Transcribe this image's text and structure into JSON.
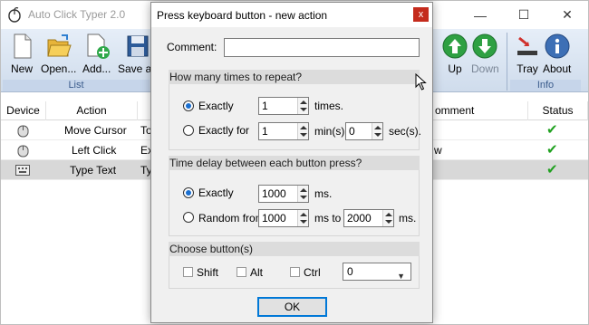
{
  "main": {
    "title": "Auto Click Typer 2.0",
    "window_controls": {
      "minimize": "—",
      "maximize": "☐",
      "close": "✕"
    },
    "toolbar": {
      "new_label": "New",
      "open_label": "Open...",
      "add_label": "Add...",
      "save_as_label": "Save as",
      "up_label": "Up",
      "down_label": "Down",
      "tray_label": "Tray",
      "about_label": "About",
      "group_list": "List",
      "group_info": "Info"
    },
    "table": {
      "headers": {
        "device": "Device",
        "action": "Action",
        "target": "",
        "comment": "omment",
        "status": "Status"
      },
      "rows": [
        {
          "action": "Move Cursor",
          "target": "To",
          "comment": ""
        },
        {
          "action": "Left Click",
          "target": "Exa",
          "comment": "w"
        },
        {
          "action": "Type Text",
          "target": "Typ",
          "comment": ""
        }
      ],
      "status_mark": "✔"
    }
  },
  "dialog": {
    "title": "Press keyboard button - new action",
    "close": "x",
    "comment_label": "Comment:",
    "comment_value": "",
    "repeat_section": "How many times to repeat?",
    "exactly_label": "Exactly",
    "exactly_value": "1",
    "times_label": "times.",
    "exactly_for_label": "Exactly for",
    "exactly_for_value": "1",
    "mins_label": "min(s)",
    "secs_value": "0",
    "secs_label": "sec(s).",
    "time_section": "Time delay between each button press?",
    "delay_exactly_label": "Exactly",
    "delay_exactly_value": "1000",
    "ms_label": "ms.",
    "random_from_label": "Random from",
    "random_from_value": "1000",
    "ms_to_label": "ms to",
    "random_to_value": "2000",
    "ms_label2": "ms.",
    "buttons_section": "Choose button(s)",
    "shift_label": "Shift",
    "alt_label": "Alt",
    "ctrl_label": "Ctrl",
    "key_value": "0",
    "ok_label": "OK"
  }
}
